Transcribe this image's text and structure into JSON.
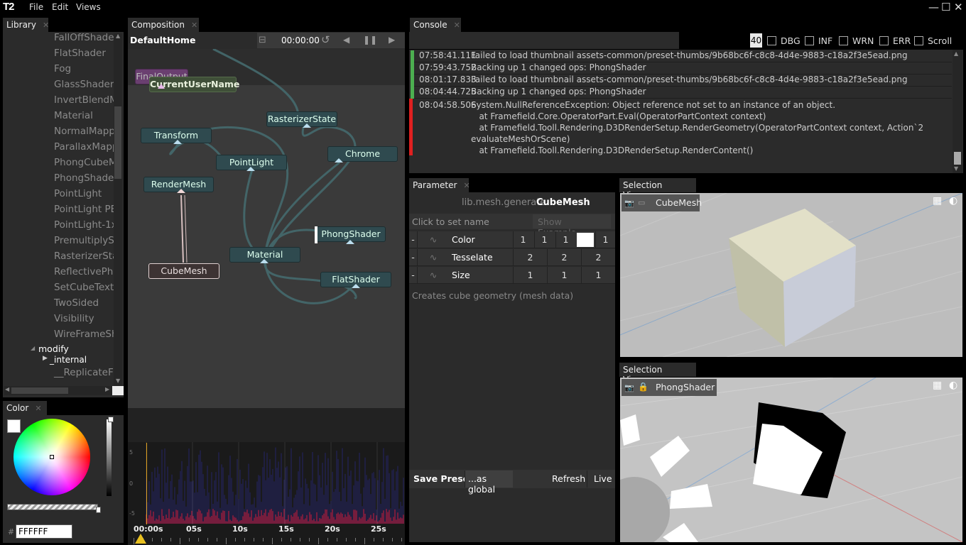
{
  "app": {
    "logo": "T2",
    "menu": [
      "File",
      "Edit",
      "Views"
    ]
  },
  "window_controls": {
    "minimize": "—",
    "maximize": "☐",
    "close": "✕"
  },
  "library": {
    "tab": "Library",
    "items": [
      "FallOffShade",
      "FlatShader",
      "Fog",
      "GlassShader",
      "InvertBlendM",
      "Material",
      "NormalMapp",
      "ParallaxMapp",
      "PhongCubeM",
      "PhongShade",
      "PointLight",
      "PointLight PE",
      "PointLight-1x",
      "PremultiplySl",
      "RasterizerSta",
      "ReflectivePhe",
      "SetCubeText",
      "TwoSided",
      "Visibility",
      "WireFrameSh"
    ],
    "folder": "modify",
    "subfolder": "_internal",
    "last_item": "__ReplicateF"
  },
  "color": {
    "tab": "Color",
    "hash": "#",
    "hex_value": "FFFFFF",
    "swatch": "#ffffff"
  },
  "composition": {
    "tab": "Composition",
    "breadcrumb": "DefaultHome",
    "time": "00:00:00",
    "nodes": {
      "final_output": "FinalOutput",
      "current_user": "CurrentUserName",
      "rasterizer": "RasterizerState",
      "transform": "Transform",
      "pointlight": "PointLight",
      "chrome": "Chrome",
      "rendermesh": "RenderMesh",
      "phongshader": "PhongShader",
      "material": "Material",
      "cubemesh": "CubeMesh",
      "flatshader": "FlatShader"
    },
    "curve_labels": [
      "5",
      "0",
      "-5"
    ],
    "timeline_labels": [
      "00:00s",
      "05s",
      "10s",
      "15s",
      "20s",
      "25s"
    ]
  },
  "console": {
    "tab": "Console",
    "level": "40",
    "filters": [
      "DBG",
      "INF",
      "WRN",
      "ERR",
      "Scroll"
    ],
    "entries": [
      {
        "time": "07:58:41.111",
        "message": "Failed to load thumbnail assets-common/preset-thumbs/9b68bc6f-c8c8-4d4e-9883-c18a2f3e5ead.png",
        "status": "#4caf50"
      },
      {
        "time": "07:59:43.752",
        "message": "Backing up 1 changed ops: PhongShader",
        "status": "#4caf50"
      },
      {
        "time": "08:01:17.833",
        "message": "Failed to load thumbnail assets-common/preset-thumbs/9b68bc6f-c8c8-4d4e-9883-c18a2f3e5ead.png",
        "status": "#4caf50"
      },
      {
        "time": "08:04:44.725",
        "message": "Backing up 1 changed ops: PhongShader",
        "status": "#4caf50"
      }
    ],
    "error": {
      "time": "08:04:58.506",
      "lines": [
        "System.NullReferenceException: Object reference not set to an instance of an object.",
        "   at Framefield.Core.OperatorPart.Eval(OperatorPartContext context)",
        "   at Framefield.Tooll.Rendering.D3DRenderSetup.RenderGeometry(OperatorPartContext context, Action`2",
        "evaluateMeshOrScene)",
        "   at Framefield.Tooll.Rendering.D3DRenderSetup.RenderContent()"
      ],
      "status": "#e02020"
    }
  },
  "parameter": {
    "tab": "Parameter",
    "namespace": "lib.mesh.generate",
    "op_name": "CubeMesh",
    "name_placeholder": "Click to set name",
    "show_example": "Show Example",
    "rows": [
      {
        "name": "Color",
        "values": [
          "1",
          "1",
          "1",
          "",
          "1"
        ]
      },
      {
        "name": "Tesselate",
        "values": [
          "2",
          "2",
          "2"
        ]
      },
      {
        "name": "Size",
        "values": [
          "1",
          "1",
          "1"
        ]
      }
    ],
    "minus": "-",
    "description": "Creates cube geometry (mesh data)",
    "save_preset": "Save Preset",
    "as_global": "...as global",
    "refresh": "Refresh",
    "live": "Live"
  },
  "selection_top": {
    "tab": "Selection View",
    "op": "CubeMesh"
  },
  "selection_bottom": {
    "tab": "Selection View",
    "op": "PhongShader"
  }
}
